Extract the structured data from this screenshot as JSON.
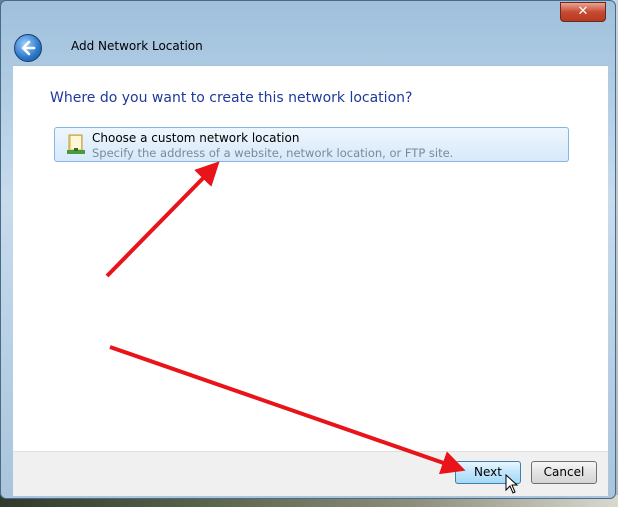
{
  "window": {
    "title": "Add Network Location",
    "close_glyph": "✕"
  },
  "main": {
    "question": "Where do you want to create this network location?",
    "option": {
      "title": "Choose a custom network location",
      "description": "Specify the address of a website, network location, or FTP site.",
      "icon": "folder-network-icon"
    }
  },
  "footer": {
    "next_label": "Next",
    "cancel_label": "Cancel"
  },
  "annotations": {
    "arrow_color": "#e8141a"
  }
}
